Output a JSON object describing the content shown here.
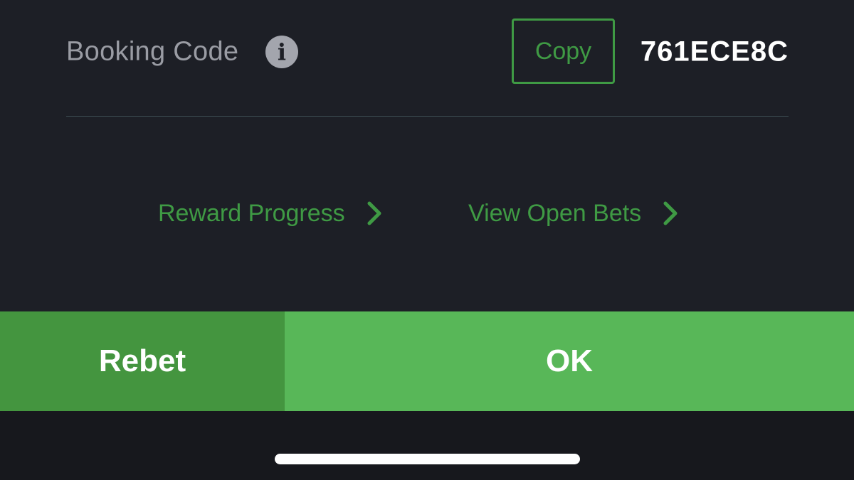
{
  "booking": {
    "label": "Booking Code",
    "info_icon": "info-icon",
    "copy_label": "Copy",
    "code": "761ECE8C"
  },
  "links": {
    "reward_progress": "Reward Progress",
    "view_open_bets": "View Open Bets",
    "chevron_icon": "chevron-right-icon"
  },
  "actions": {
    "rebet_label": "Rebet",
    "ok_label": "OK"
  },
  "colors": {
    "background": "#1d1f26",
    "accent_green": "#3f9a44",
    "rebet_green": "#44953f",
    "ok_green": "#58b758",
    "label_gray": "#9a9ca4"
  }
}
